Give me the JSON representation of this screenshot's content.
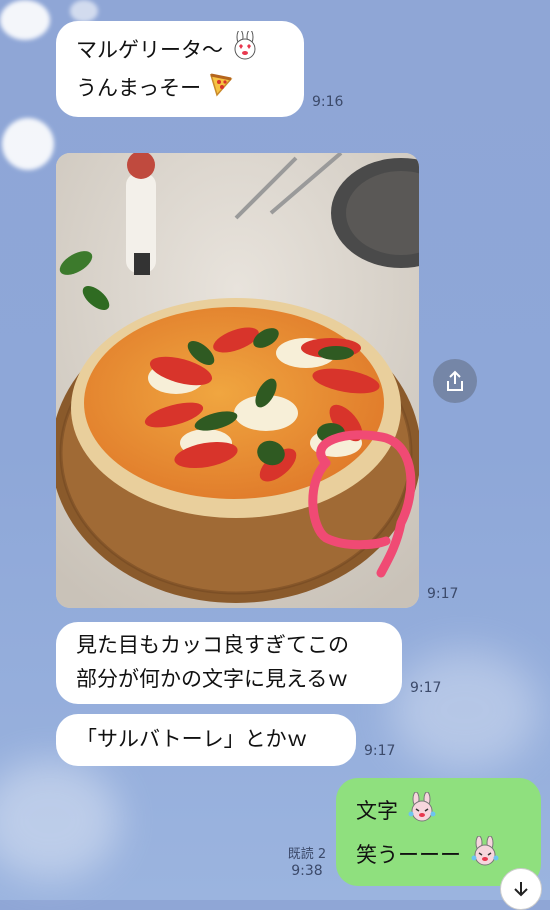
{
  "messages": [
    {
      "line1": "マルゲリータ〜",
      "line2": "うんまっそー",
      "time": "9:16"
    },
    {
      "time": "9:17"
    },
    {
      "line1": "見た目もカッコ良すぎてこの",
      "line2": "部分が何かの文字に見えるｗ",
      "time": "9:17"
    },
    {
      "line1": "「サルバトーレ」とかｗ",
      "time": "9:17"
    },
    {
      "line1": "文字",
      "line2": "笑うーーー",
      "time": "9:38",
      "read": "既読 2"
    }
  ],
  "colors": {
    "background": "#8fa6d6",
    "own_bubble": "#8fe07e",
    "other_bubble": "#ffffff",
    "annotation": "#f04a74"
  },
  "icons": {
    "share": "share-icon",
    "scroll": "arrow-down-icon",
    "pizza": "pizza-emoji",
    "sticker": "bunny-sticker"
  }
}
